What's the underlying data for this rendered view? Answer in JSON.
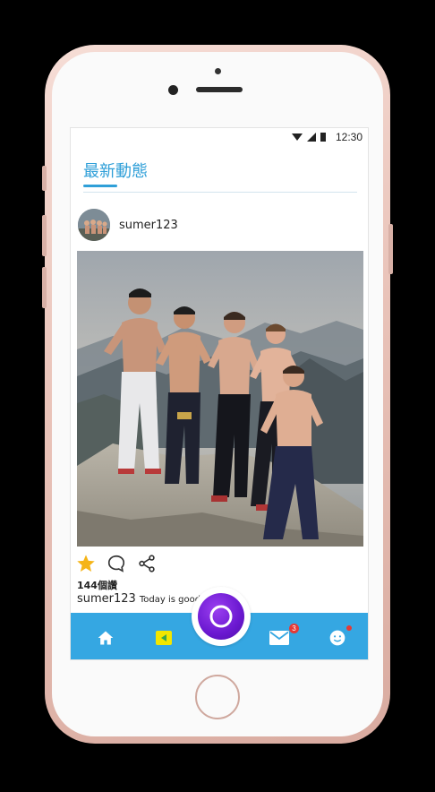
{
  "status": {
    "time": "12:30"
  },
  "header": {
    "title": "最新動態"
  },
  "post": {
    "author": "sumer123",
    "likes_text": "144個讚",
    "caption_user": "sumer123",
    "caption_text": "Today is good."
  },
  "nav": {
    "mail_badge": "3"
  },
  "colors": {
    "accent": "#2f9fd8",
    "nav_bar": "#35a7e2",
    "star": "#f5b417",
    "center_button": "#6a18d0",
    "badge": "#e53935"
  },
  "icons": [
    "home-icon",
    "video-icon",
    "record-icon",
    "mail-icon",
    "profile-icon",
    "star-icon",
    "comment-icon",
    "share-icon"
  ]
}
